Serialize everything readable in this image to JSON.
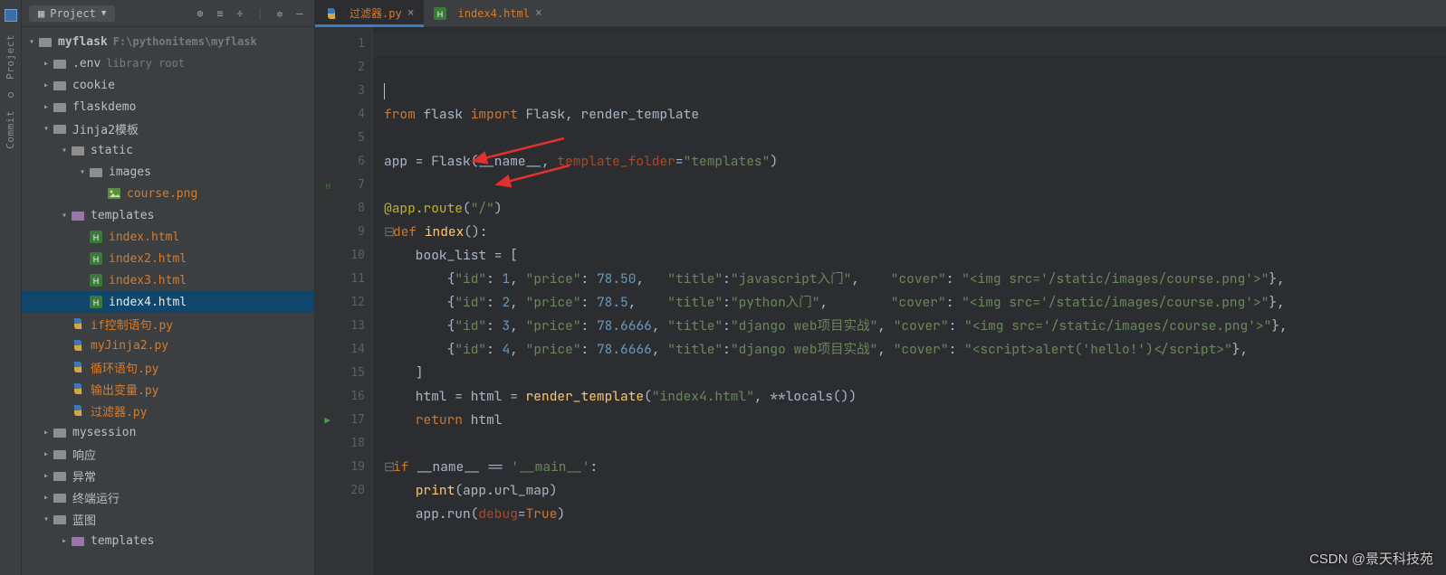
{
  "sidebar": {
    "title": "Project",
    "root": {
      "name": "myflask",
      "path": "F:\\pythonitems\\myflask"
    },
    "tree": [
      {
        "d": 1,
        "chev": ">",
        "ic": "fld",
        "label": ".env",
        "dim": "library root"
      },
      {
        "d": 1,
        "chev": ">",
        "ic": "fld",
        "label": "cookie"
      },
      {
        "d": 1,
        "chev": ">",
        "ic": "fld",
        "label": "flaskdemo"
      },
      {
        "d": 1,
        "chev": "v",
        "ic": "fld",
        "label": "Jinja2模板"
      },
      {
        "d": 2,
        "chev": "v",
        "ic": "fld",
        "label": "static"
      },
      {
        "d": 3,
        "chev": "v",
        "ic": "fld",
        "label": "images"
      },
      {
        "d": 4,
        "chev": " ",
        "ic": "img",
        "label": "course.png",
        "warn": true
      },
      {
        "d": 2,
        "chev": "v",
        "ic": "fld-p",
        "label": "templates"
      },
      {
        "d": 3,
        "chev": " ",
        "ic": "h",
        "label": "index.html",
        "warn": true
      },
      {
        "d": 3,
        "chev": " ",
        "ic": "h",
        "label": "index2.html",
        "warn": true
      },
      {
        "d": 3,
        "chev": " ",
        "ic": "h",
        "label": "index3.html",
        "warn": true
      },
      {
        "d": 3,
        "chev": " ",
        "ic": "h",
        "label": "index4.html",
        "warn": true,
        "sel": true
      },
      {
        "d": 2,
        "chev": " ",
        "ic": "py",
        "label": "if控制语句.py",
        "warn": true
      },
      {
        "d": 2,
        "chev": " ",
        "ic": "py",
        "label": "myJinja2.py",
        "warn": true
      },
      {
        "d": 2,
        "chev": " ",
        "ic": "py",
        "label": "循环语句.py",
        "warn": true
      },
      {
        "d": 2,
        "chev": " ",
        "ic": "py",
        "label": "输出变量.py",
        "warn": true
      },
      {
        "d": 2,
        "chev": " ",
        "ic": "py",
        "label": "过滤器.py",
        "warn": true
      },
      {
        "d": 1,
        "chev": ">",
        "ic": "fld",
        "label": "mysession"
      },
      {
        "d": 1,
        "chev": ">",
        "ic": "fld",
        "label": "响应"
      },
      {
        "d": 1,
        "chev": ">",
        "ic": "fld",
        "label": "异常"
      },
      {
        "d": 1,
        "chev": ">",
        "ic": "fld",
        "label": "终端运行"
      },
      {
        "d": 1,
        "chev": "v",
        "ic": "fld",
        "label": "蓝图"
      },
      {
        "d": 2,
        "chev": ">",
        "ic": "fld-p",
        "label": "templates"
      }
    ]
  },
  "tabs": [
    {
      "ic": "py",
      "label": "过滤器.py",
      "warn": true,
      "active": true
    },
    {
      "ic": "h",
      "label": "index4.html",
      "warn": true,
      "active": false
    }
  ],
  "code": {
    "lines": 20,
    "t": {
      "l2a": "from",
      "l2b": "flask",
      "l2c": "import",
      "l2d": "Flask, render_template",
      "l4a": "app = Flask(__name__",
      "l4b": "template_folder",
      "l4c": "\"templates\"",
      "l6": "@app.route",
      "l6s": "(\"/\")",
      "l7a": "def ",
      "l7b": "index",
      "l7c": "():",
      "l8": "    book_list = [",
      "l9": "        {\"id\": 1, \"price\": 78.50,   \"title\":\"javascript入门\",    \"cover\": \"<img src='/static/images/course.png'>\"},",
      "l10": "        {\"id\": 2, \"price\": 78.5,    \"title\":\"python入门\",        \"cover\": \"<img src='/static/images/course.png'>\"},",
      "l11": "        {\"id\": 3, \"price\": 78.6666, \"title\":\"django web项目实战\", \"cover\": \"<img src='/static/images/course.png'>\"},",
      "l12": "        {\"id\": 4, \"price\": 78.6666, \"title\":\"django web项目实战\", \"cover\": \"<script>alert('hello!')</script>\"},",
      "l13": "    ]",
      "l14a": "    html = ",
      "l14b": "render_template",
      "l14c": "(\"index4.html\", **locals())",
      "l15a": "    ",
      "l15b": "return ",
      "l15c": "html",
      "l17a": "if ",
      "l17b": "__name__ == ",
      "l17c": "'__main__'",
      "l17d": ":",
      "l18a": "    ",
      "l18b": "print",
      "l18c": "(app.url_map)",
      "l19a": "    app.run(",
      "l19b": "debug",
      "l19c": "=",
      "l19d": "True",
      "l19e": ")"
    }
  },
  "rail": {
    "project": "Project",
    "commit": "Commit"
  },
  "watermark": "CSDN @景天科技苑"
}
